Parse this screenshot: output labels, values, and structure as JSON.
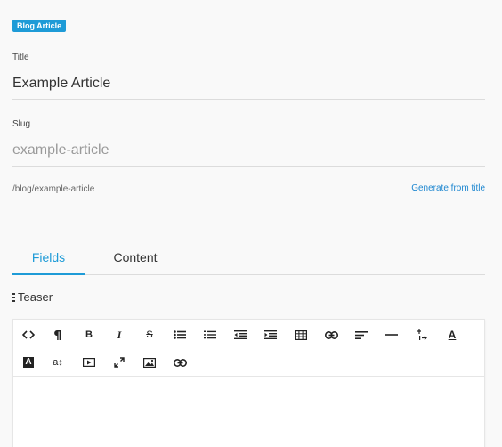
{
  "badge": "Blog Article",
  "title_field": {
    "label": "Title",
    "value": "Example Article"
  },
  "slug_field": {
    "label": "Slug",
    "placeholder": "example-article"
  },
  "path": "/blog/example-article",
  "generate_link": "Generate from title",
  "tabs": [
    {
      "label": "Fields",
      "active": true
    },
    {
      "label": "Content",
      "active": false
    }
  ],
  "section": {
    "title": "Teaser"
  },
  "toolbar": {
    "row1": [
      "code-view",
      "paragraph",
      "bold",
      "italic",
      "strikethrough",
      "unordered-list",
      "ordered-list",
      "outdent",
      "indent",
      "table",
      "link",
      "align",
      "horizontal-rule",
      "text-direction",
      "font-color"
    ],
    "row2": [
      "background-color",
      "font-size",
      "video",
      "fullscreen",
      "image",
      "link"
    ],
    "bold_glyph": "B",
    "italic_glyph": "I",
    "strike_glyph": "S",
    "fontcolor_glyph": "A",
    "bgcolor_glyph": "A",
    "fontsize_glyph": "a↕"
  },
  "colors": {
    "accent": "#1e9bd7",
    "link": "#1e87d0",
    "background": "#f9f9f9"
  }
}
